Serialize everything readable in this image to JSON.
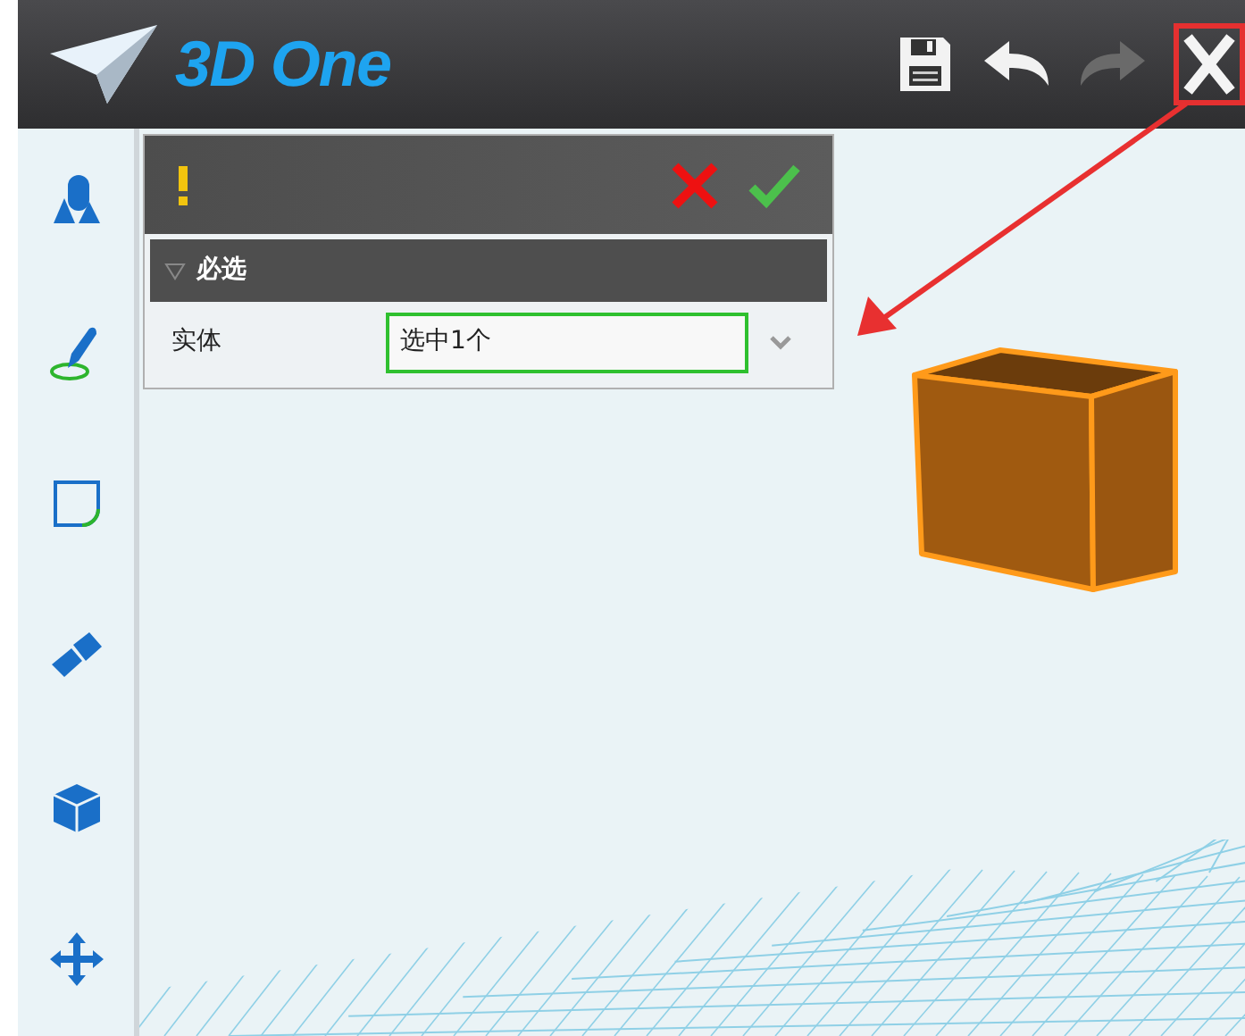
{
  "app": {
    "logo_text": "3D One"
  },
  "panel": {
    "section": {
      "title": "必选",
      "expanded": true
    },
    "fields": [
      {
        "label": "实体",
        "value": "选中1个"
      }
    ]
  }
}
